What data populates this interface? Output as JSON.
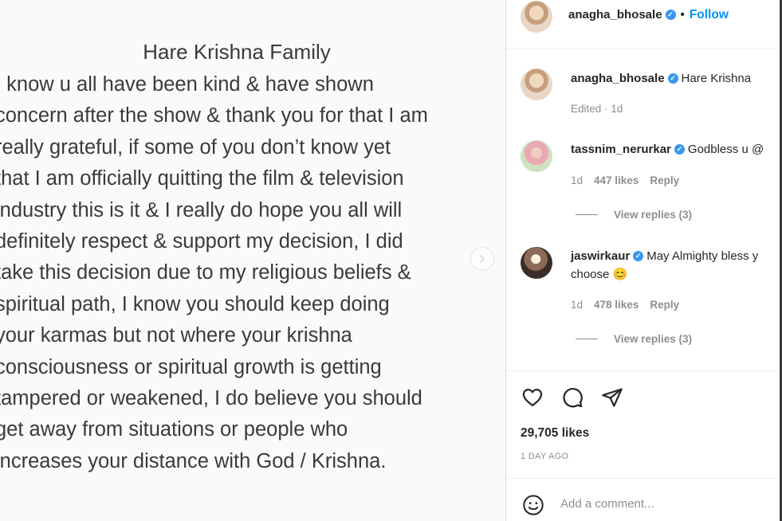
{
  "post": {
    "title": "Hare Krishna Family",
    "lines": [
      "I know u all have been kind & have shown",
      "concern after the show & thank you for that I am",
      "really grateful, if some of you don’t know yet",
      "that I am officially quitting the film & television",
      "industry this is it & I really do hope you all will",
      "definitely respect & support my decision, I did",
      "take this decision due to my religious beliefs &",
      "spiritual path, I know you should keep doing",
      "your karmas but not where your krishna",
      "consciousness or spiritual growth is getting",
      "tampered or weakened, I do believe you should",
      "get away from situations or people who",
      "increases your distance with God / Krishna."
    ]
  },
  "header": {
    "username": "anagha_bhosale",
    "separator": "•",
    "follow_label": "Follow"
  },
  "caption": {
    "username": "anagha_bhosale",
    "text": "Hare Krishna",
    "meta": "Edited · 1d"
  },
  "comments": [
    {
      "username": "tassnim_nerurkar",
      "text": "Godbless u @",
      "time": "1d",
      "likes": "447 likes",
      "reply_label": "Reply",
      "view_replies": "View replies (3)"
    },
    {
      "username": "jaswirkaur",
      "text": "May Almighty bless y",
      "text_line2": "choose 😊",
      "time": "1d",
      "likes": "478 likes",
      "reply_label": "Reply",
      "view_replies": "View replies (3)"
    }
  ],
  "actions": {
    "icons": [
      "heart-icon",
      "comment-icon",
      "share-icon"
    ]
  },
  "stats": {
    "likes": "29,705 likes",
    "date": "1 DAY AGO"
  },
  "composer": {
    "emoji_icon": "emoji-icon",
    "placeholder": "Add a comment..."
  },
  "colors": {
    "link_blue": "#0095f6",
    "verified_blue": "#3897f0",
    "muted_gray": "#8e8e8e",
    "text": "#262626"
  }
}
